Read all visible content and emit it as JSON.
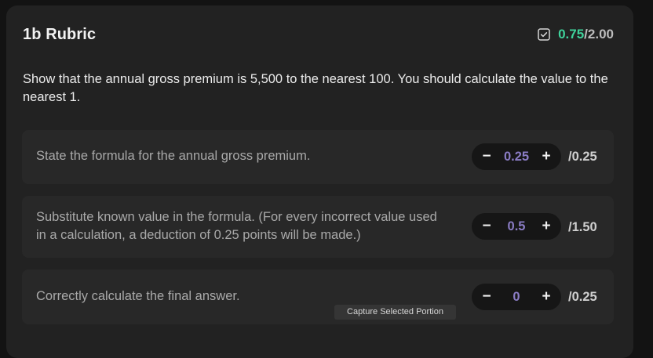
{
  "rubric": {
    "title": "1b Rubric",
    "score": {
      "icon": "checkbox-icon",
      "earned": "0.75",
      "separator": "/",
      "total": "2.00",
      "earned_color": "#3fd29b"
    },
    "question": "Show that the annual gross premium is 5,500 to the nearest 100. You should calculate the value to the nearest 1.",
    "criteria": [
      {
        "text": "State the formula for the annual gross premium.",
        "minus": "−",
        "value": "0.25",
        "plus": "+",
        "max": "/0.25"
      },
      {
        "text": "Substitute known value in the formula. (For every incorrect value used in a calculation, a deduction of 0.25 points will be made.)",
        "minus": "−",
        "value": "0.5",
        "plus": "+",
        "max": "/1.50"
      },
      {
        "text": "Correctly calculate the final answer.",
        "minus": "−",
        "value": "0",
        "plus": "+",
        "max": "/0.25"
      }
    ]
  },
  "tooltip": {
    "text": "Capture Selected Portion"
  }
}
